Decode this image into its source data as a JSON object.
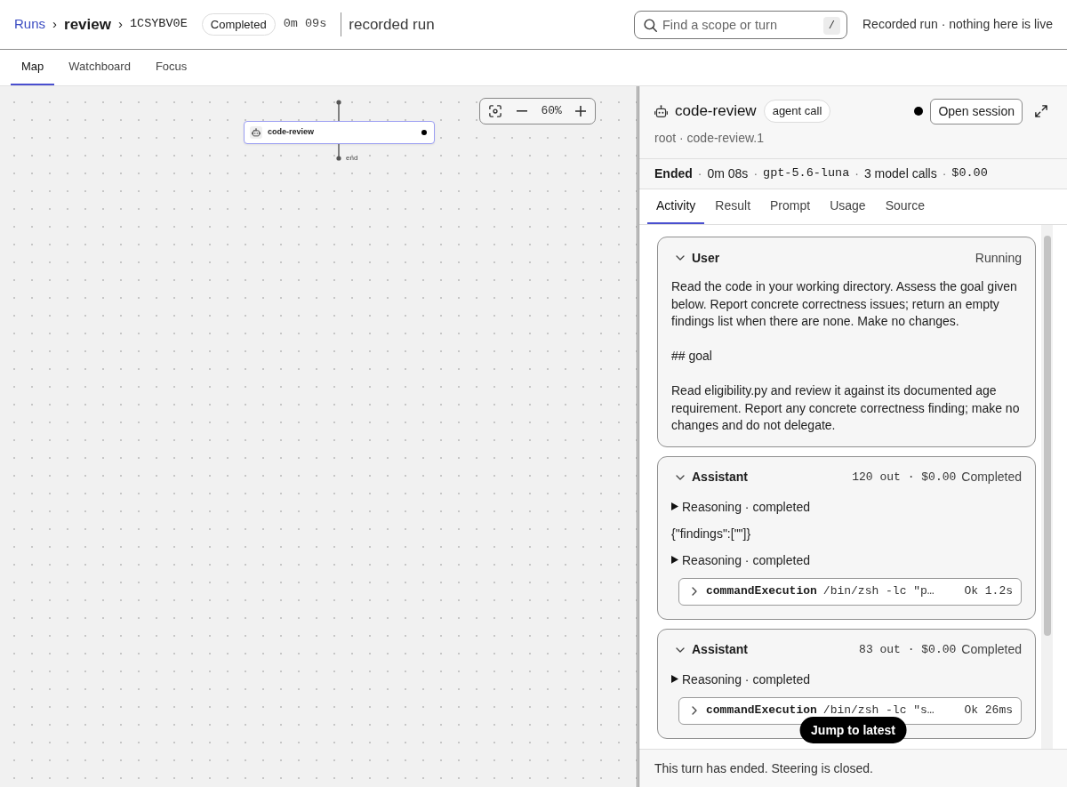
{
  "breadcrumb": [
    {
      "kind": "link",
      "text": "Runs"
    },
    {
      "kind": "separator",
      "text": "›"
    },
    {
      "kind": "current",
      "text": "review"
    },
    {
      "kind": "separator",
      "text": "›"
    },
    {
      "kind": "id",
      "text": "1CSYBV0E"
    }
  ],
  "run_status": "Completed",
  "duration": "0m 09s",
  "subtitle": "recorded run",
  "search": {
    "placeholder": "Find a scope or turn",
    "shortcut": "/"
  },
  "notice": "Recorded run · nothing here is live",
  "view_tabs": [
    {
      "label": "Map",
      "selected": true
    },
    {
      "label": "Watchboard",
      "selected": false
    },
    {
      "label": "Focus",
      "selected": false
    }
  ],
  "map": {
    "zoom": "60%",
    "node": {
      "label": "code-review"
    },
    "end_label": "end"
  },
  "detail": {
    "title": "code-review",
    "badge": "agent call",
    "action": "Open session",
    "path": "root · code-review.1",
    "stats": [
      {
        "kind": "label",
        "text": "Ended"
      },
      {
        "kind": "separator",
        "text": "·"
      },
      {
        "kind": "text",
        "text": "0m 08s"
      },
      {
        "kind": "separator",
        "text": "·"
      },
      {
        "kind": "mono",
        "text": "gpt-5.6-luna"
      },
      {
        "kind": "separator",
        "text": "·"
      },
      {
        "kind": "text",
        "text": "3 model calls"
      },
      {
        "kind": "separator",
        "text": "·"
      },
      {
        "kind": "mono",
        "text": "$0.00"
      }
    ]
  },
  "detail_tabs": [
    {
      "label": "Activity",
      "selected": true
    },
    {
      "label": "Result",
      "selected": false
    },
    {
      "label": "Prompt",
      "selected": false
    },
    {
      "label": "Usage",
      "selected": false
    },
    {
      "label": "Source",
      "selected": false
    }
  ],
  "activity": [
    {
      "role": "User",
      "status": "Running",
      "expanded": true,
      "items": [
        {
          "kind": "text",
          "text": "Read the code in your working directory. Assess the goal given below. Report concrete correctness issues; return an empty findings list when there are none. Make no changes."
        },
        {
          "kind": "text",
          "text": "## goal"
        },
        {
          "kind": "text",
          "text": "Read eligibility.py and review it against its documented age requirement. Report any concrete correctness finding; make no changes and do not delegate."
        }
      ]
    },
    {
      "role": "Assistant",
      "usage": "120 out · $0.00",
      "status": "Completed",
      "expanded": true,
      "items": [
        {
          "kind": "reasoning",
          "text": "Reasoning · completed",
          "expanded": false
        },
        {
          "kind": "output",
          "text": "{\"findings\":[\"\"]}"
        },
        {
          "kind": "reasoning",
          "text": "Reasoning · completed",
          "expanded": false
        },
        {
          "kind": "command",
          "name": "commandExecution",
          "command": "/bin/zsh -lc \"p…",
          "result": "Ok 1.2s",
          "expanded": false
        }
      ]
    },
    {
      "role": "Assistant",
      "usage": "83 out · $0.00",
      "status": "Completed",
      "expanded": true,
      "items": [
        {
          "kind": "reasoning",
          "text": "Reasoning · completed",
          "expanded": false
        },
        {
          "kind": "command",
          "name": "commandExecution",
          "command": "/bin/zsh -lc \"s…",
          "result": "Ok 26ms",
          "expanded": false
        }
      ]
    }
  ],
  "jump_button": "Jump to latest",
  "footer": "This turn has ended. Steering is closed."
}
